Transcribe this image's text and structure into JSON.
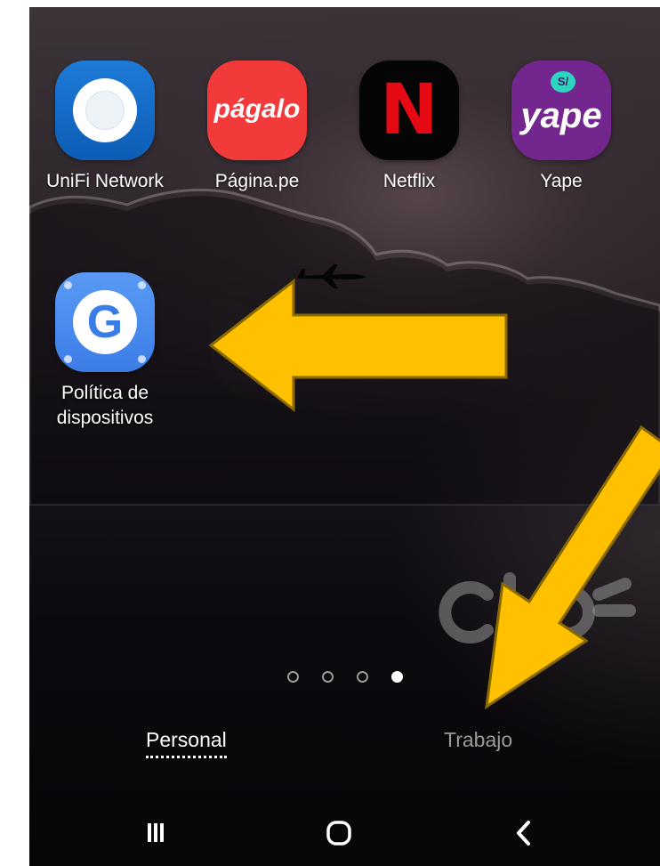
{
  "home": {
    "apps": [
      {
        "name": "UniFi Network"
      },
      {
        "name": "Página.pe",
        "icon_text": "págalo"
      },
      {
        "name": "Netflix",
        "icon_text": "N"
      },
      {
        "name": "Yape",
        "icon_text": "yape",
        "badge_text": "S/"
      }
    ],
    "work_app": {
      "name": "Política de dispositivos",
      "icon_text": "G"
    },
    "page_indicator": {
      "pages": 4,
      "current": 4
    },
    "profile_tabs": {
      "personal": "Personal",
      "work": "Trabajo",
      "selected": "Personal"
    },
    "watermark_text": "claro"
  },
  "nav": {
    "recents": "recents-icon",
    "home": "home-icon",
    "back": "back-icon"
  },
  "colors": {
    "annotation_arrow": "#ffc000",
    "annotation_arrow_outline": "#8a6a00",
    "netflix_red": "#e50914",
    "pagalo_red": "#f23a3a",
    "yape_purple": "#74268f",
    "unifi_blue": "#1e7ad8",
    "policy_blue": "#3b7de6"
  }
}
